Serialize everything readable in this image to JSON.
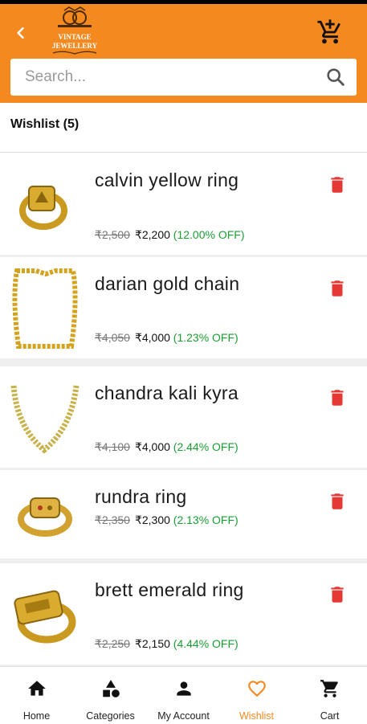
{
  "header": {
    "logo_text_line1": "VINTAGE",
    "logo_text_line2": "JEWELLERY",
    "brand_color": "#f4891f"
  },
  "search": {
    "placeholder": "Search..."
  },
  "wishlist": {
    "title": "Wishlist (5)",
    "items": [
      {
        "name": "calvin yellow ring",
        "mrp": "₹2,500",
        "price": "₹2,200",
        "discount": "(12.00% OFF)",
        "image": "ring"
      },
      {
        "name": "darian gold chain",
        "mrp": "₹4,050",
        "price": "₹4,000",
        "discount": "(1.23% OFF)",
        "image": "chain"
      },
      {
        "name": "chandra kali kyra",
        "mrp": "₹4,100",
        "price": "₹4,000",
        "discount": "(2.44% OFF)",
        "image": "chain-stone"
      },
      {
        "name": "rundra ring",
        "mrp": "₹2,350",
        "price": "₹2,300",
        "discount": "(2.13% OFF)",
        "image": "ring"
      },
      {
        "name": "brett emerald ring",
        "mrp": "₹2,250",
        "price": "₹2,150",
        "discount": "(4.44% OFF)",
        "image": "ring"
      }
    ]
  },
  "nav": {
    "items": [
      {
        "label": "Home",
        "icon": "home-icon"
      },
      {
        "label": "Categories",
        "icon": "categories-icon"
      },
      {
        "label": "My Account",
        "icon": "account-icon"
      },
      {
        "label": "Wishlist",
        "icon": "heart-icon",
        "active": true
      },
      {
        "label": "Cart",
        "icon": "cart-icon"
      }
    ]
  },
  "colors": {
    "accent": "#f4891f",
    "delete": "#e53935",
    "discount": "#1a9e33"
  }
}
